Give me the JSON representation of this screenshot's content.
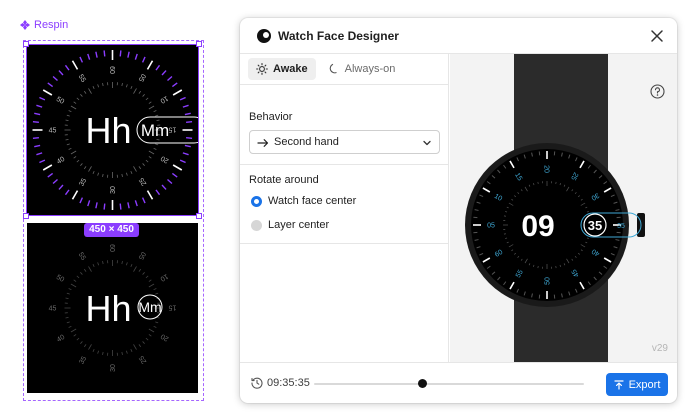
{
  "canvas": {
    "frame_label": "Respin",
    "size_badge": "450 × 450",
    "face_hours_text": "Hh",
    "face_minutes_text": "Mm",
    "dial_numbers": [
      "60",
      "05",
      "10",
      "15",
      "20",
      "25",
      "30",
      "35",
      "40",
      "45",
      "50",
      "55"
    ],
    "accent_color": "#8b3dff"
  },
  "dialog": {
    "title": "Watch Face Designer",
    "tabs": [
      {
        "label": "Awake",
        "icon": "sun-icon",
        "active": true
      },
      {
        "label": "Always-on",
        "icon": "moon-icon",
        "active": false
      }
    ],
    "behavior": {
      "label": "Behavior",
      "value": "Second hand",
      "icon": "arrow-right-icon"
    },
    "rotate": {
      "label": "Rotate around",
      "options": [
        {
          "label": "Watch face center",
          "selected": true
        },
        {
          "label": "Layer center",
          "selected": false
        }
      ]
    },
    "preview": {
      "hour": "09",
      "minute": "35",
      "second": "35",
      "version": "v29",
      "dial_numbers": [
        "60",
        "05",
        "10",
        "15",
        "20",
        "25",
        "30",
        "35",
        "40",
        "45",
        "50",
        "55"
      ],
      "accent_color": "#3fa9d6"
    },
    "footer": {
      "time": "09:35:35",
      "progress": 0.4,
      "export_label": "Export"
    },
    "primary_color": "#1a73e8"
  }
}
